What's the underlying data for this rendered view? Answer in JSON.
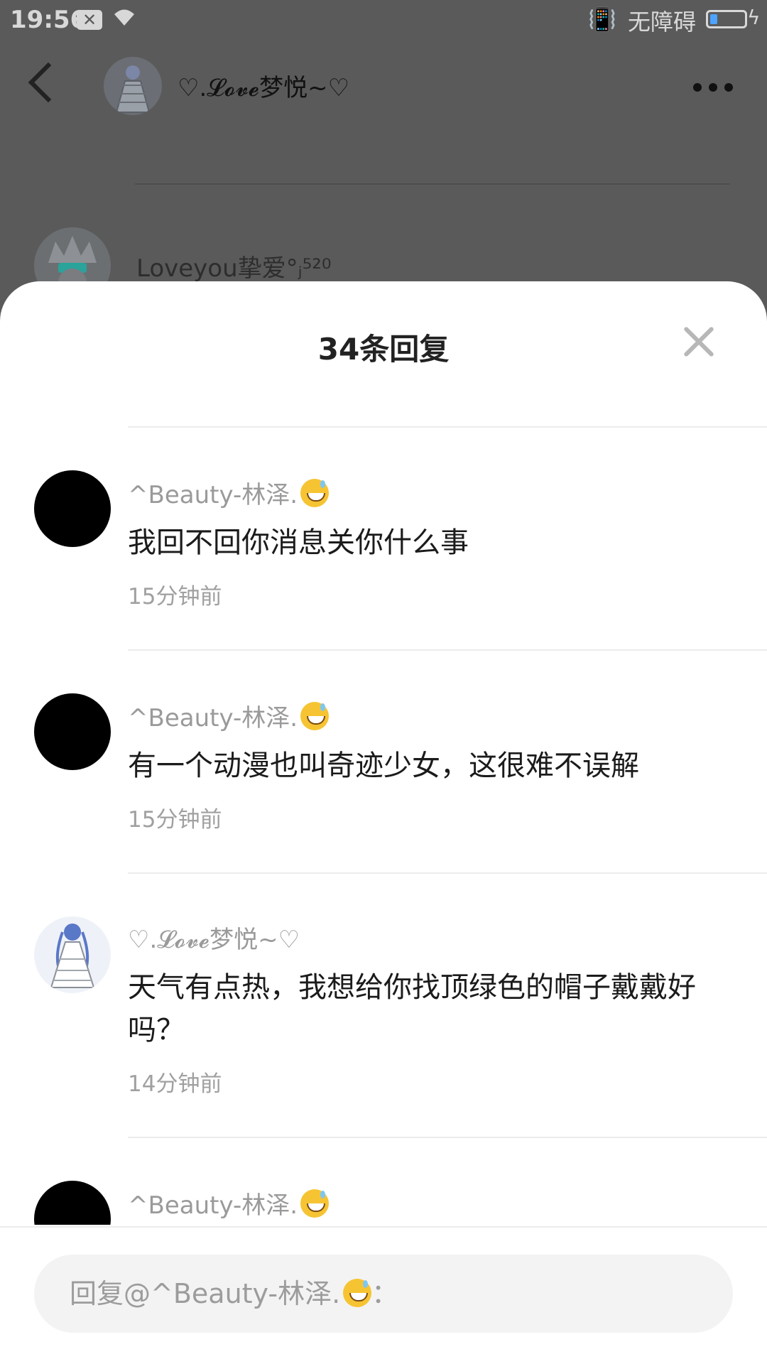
{
  "status_bar": {
    "time": "19:56",
    "network": "无障碍"
  },
  "background_page": {
    "header_title": "♡.𝓛𝓸𝓿𝓮梦悦~♡",
    "second_user": "Loveyou挚爱°ⱼ⁵²⁰"
  },
  "sheet": {
    "title": "34条回复",
    "replies": [
      {
        "name": "^Beauty-林泽.",
        "emoji": "sweat-smile-emoji",
        "text": "我回不回你消息关你什么事",
        "time": "15分钟前"
      },
      {
        "name": "^Beauty-林泽.",
        "emoji": "sweat-smile-emoji",
        "text": "有一个动漫也叫奇迹少女，这很难不误解",
        "time": "15分钟前"
      },
      {
        "name": "♡.𝓛𝓸𝓿𝓮梦悦~♡",
        "text": "天气有点热，我想给你找顶绿色的帽子戴戴好吗？",
        "time": "14分钟前"
      },
      {
        "name": "^Beauty-林泽.",
        "emoji": "sweat-smile-emoji",
        "text": "",
        "time": ""
      }
    ]
  },
  "reply_input": {
    "placeholder": "回复@^Beauty-林泽."
  },
  "colors": {
    "overlay_bg": "#5a5a5a",
    "sheet_bg": "#ffffff",
    "muted_text": "#9a9a9a",
    "input_bg": "#f3f3f3"
  }
}
